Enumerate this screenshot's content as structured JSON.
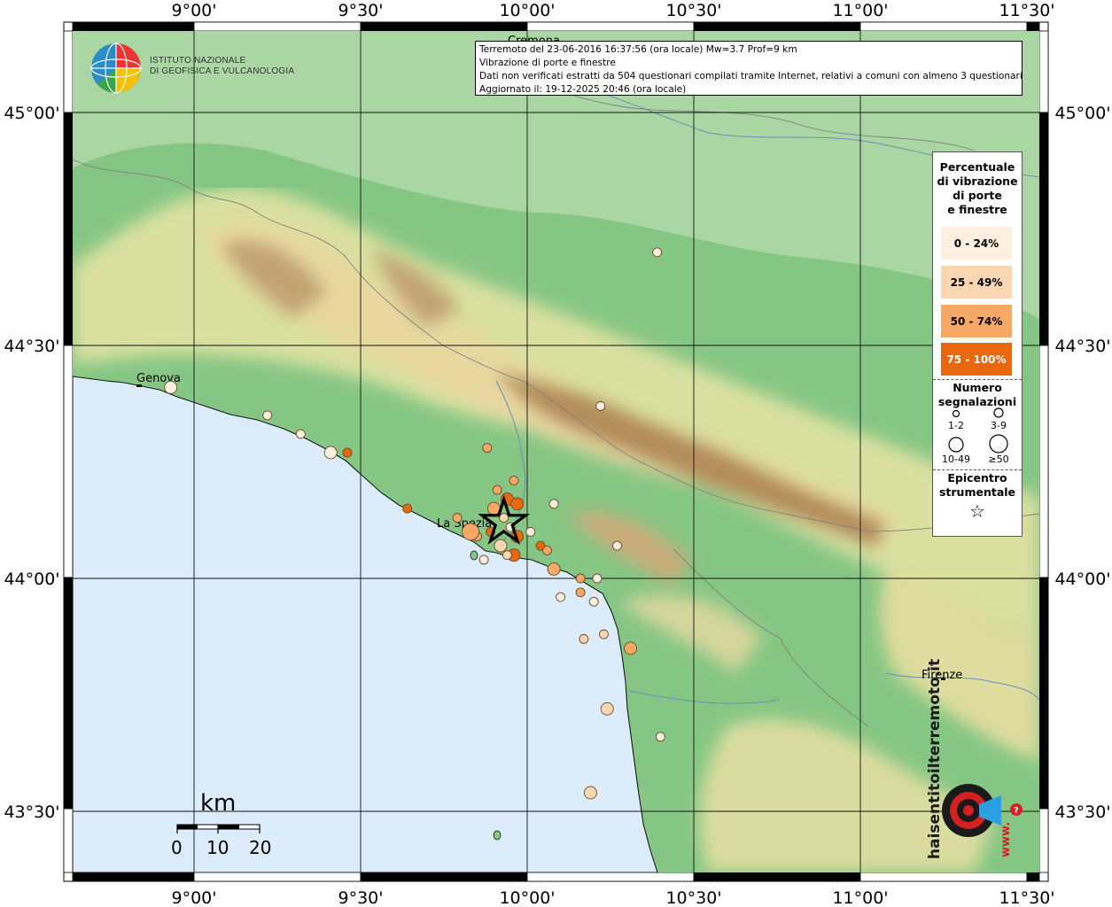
{
  "info": {
    "line1": "Terremoto del 23-06-2016 16:37:56 (ora locale) Mw=3.7 Prof=9 km",
    "line2": "Vibrazione di porte e finestre",
    "line3": "Dati non verificati estratti da 504 questionari compilati tramite Internet, relativi a comuni con almeno 3 questionari.",
    "line4": "Aggiornato il: 19-12-2025 20:46 (ora locale)"
  },
  "logo": {
    "line1": "ISTITUTO NAZIONALE",
    "line2": "DI GEOFISICA E VULCANOLOGIA"
  },
  "grid": {
    "lon_labels": [
      "9°00'",
      "9°30'",
      "10°00'",
      "10°30'",
      "11°00'",
      "11°30'"
    ],
    "lat_labels": [
      "45°00'",
      "44°30'",
      "44°00'",
      "43°30'"
    ]
  },
  "places": {
    "genova": "Genova",
    "la_spezia": "La Spezia",
    "firenze": "Firenze",
    "cremona": "Cremona"
  },
  "legend": {
    "title": "Percentuale\ndi vibrazione\ndi porte\ne finestre",
    "classes": [
      {
        "label": "0 - 24%",
        "color": "#fdf0e0"
      },
      {
        "label": "25 - 49%",
        "color": "#fbd6b2"
      },
      {
        "label": "50 - 74%",
        "color": "#f7a866"
      },
      {
        "label": "75 - 100%",
        "color": "#e86810"
      }
    ],
    "count_title": "Numero\nsegnalazioni",
    "sizes": [
      "1-2",
      "3-9",
      "10-49",
      "≥50"
    ],
    "epicenter_title": "Epicentro\nstrumentale",
    "epicenter_symbol": "☆"
  },
  "scale": {
    "unit": "km",
    "labels": [
      "0",
      "10",
      "20"
    ]
  },
  "watermark": {
    "text": "haisentitoilterremoto.it",
    "url": "www."
  },
  "colors": {
    "sea": "#dcecfa",
    "low_land": "#8cc88c",
    "hills": "#e8dc9c",
    "mountains": "#b08c58"
  },
  "reports": [
    {
      "id": "genova",
      "lon": 8.93,
      "lat": 44.41,
      "pct": 0,
      "size": 2
    },
    {
      "id": "r1",
      "lon": 9.22,
      "lat": 44.35,
      "pct": 0,
      "size": 1
    },
    {
      "id": "r2",
      "lon": 9.32,
      "lat": 44.31,
      "pct": 0,
      "size": 1
    },
    {
      "id": "r3",
      "lon": 9.41,
      "lat": 44.27,
      "pct": 0,
      "size": 2
    },
    {
      "id": "r4",
      "lon": 9.46,
      "lat": 44.27,
      "pct": 3,
      "size": 1
    },
    {
      "id": "r5",
      "lon": 9.64,
      "lat": 44.15,
      "pct": 3,
      "size": 1
    },
    {
      "id": "r6",
      "lon": 9.79,
      "lat": 44.13,
      "pct": 2,
      "size": 1
    },
    {
      "id": "r7",
      "lon": 9.85,
      "lat": 44.09,
      "pct": 2,
      "size": 1
    },
    {
      "id": "spezia",
      "lon": 9.83,
      "lat": 44.1,
      "pct": 2,
      "size": 3
    },
    {
      "id": "r8",
      "lon": 9.87,
      "lat": 44.04,
      "pct": 0,
      "size": 1
    },
    {
      "id": "r9",
      "lon": 9.92,
      "lat": 44.07,
      "pct": 1,
      "size": 2
    },
    {
      "id": "r10",
      "lon": 9.96,
      "lat": 44.05,
      "pct": 3,
      "size": 2
    },
    {
      "id": "r11",
      "lon": 9.94,
      "lat": 44.05,
      "pct": 1,
      "size": 1
    },
    {
      "id": "r12",
      "lon": 9.95,
      "lat": 44.11,
      "pct": 0,
      "size": 1
    },
    {
      "id": "r13",
      "lon": 9.9,
      "lat": 44.15,
      "pct": 2,
      "size": 2
    },
    {
      "id": "r14",
      "lon": 9.94,
      "lat": 44.17,
      "pct": 3,
      "size": 2
    },
    {
      "id": "r15",
      "lon": 9.97,
      "lat": 44.16,
      "pct": 3,
      "size": 2
    },
    {
      "id": "r16",
      "lon": 9.91,
      "lat": 44.19,
      "pct": 2,
      "size": 1
    },
    {
      "id": "r17",
      "lon": 9.96,
      "lat": 44.21,
      "pct": 2,
      "size": 1
    },
    {
      "id": "r18",
      "lon": 9.88,
      "lat": 44.28,
      "pct": 2,
      "size": 1
    },
    {
      "id": "r19",
      "lon": 9.93,
      "lat": 44.13,
      "pct": 1,
      "size": 1
    },
    {
      "id": "r20",
      "lon": 9.89,
      "lat": 44.1,
      "pct": 3,
      "size": 1
    },
    {
      "id": "r21",
      "lon": 9.97,
      "lat": 44.09,
      "pct": 3,
      "size": 2
    },
    {
      "id": "r22",
      "lon": 10.01,
      "lat": 44.1,
      "pct": 0,
      "size": 1
    },
    {
      "id": "r23",
      "lon": 10.04,
      "lat": 44.07,
      "pct": 3,
      "size": 1
    },
    {
      "id": "r24",
      "lon": 10.06,
      "lat": 44.06,
      "pct": 2,
      "size": 1
    },
    {
      "id": "r25",
      "lon": 10.08,
      "lat": 44.02,
      "pct": 2,
      "size": 2
    },
    {
      "id": "r26",
      "lon": 10.08,
      "lat": 44.16,
      "pct": 0,
      "size": 1
    },
    {
      "id": "r27",
      "lon": 10.16,
      "lat": 43.97,
      "pct": 2,
      "size": 1
    },
    {
      "id": "r28",
      "lon": 10.16,
      "lat": 44.0,
      "pct": 2,
      "size": 1
    },
    {
      "id": "r29",
      "lon": 10.21,
      "lat": 44.0,
      "pct": 0,
      "size": 1
    },
    {
      "id": "r30",
      "lon": 10.1,
      "lat": 43.96,
      "pct": 0,
      "size": 1
    },
    {
      "id": "r31",
      "lon": 10.2,
      "lat": 43.95,
      "pct": 0,
      "size": 1
    },
    {
      "id": "r32",
      "lon": 10.17,
      "lat": 43.87,
      "pct": 1,
      "size": 1
    },
    {
      "id": "r33",
      "lon": 10.23,
      "lat": 43.88,
      "pct": 1,
      "size": 1
    },
    {
      "id": "r34",
      "lon": 10.31,
      "lat": 43.85,
      "pct": 2,
      "size": 2
    },
    {
      "id": "r35",
      "lon": 10.27,
      "lat": 44.07,
      "pct": 0,
      "size": 1
    },
    {
      "id": "r36",
      "lon": 10.22,
      "lat": 44.37,
      "pct": 0,
      "size": 1
    },
    {
      "id": "r37",
      "lon": 10.39,
      "lat": 44.7,
      "pct": 0,
      "size": 1
    },
    {
      "id": "r38",
      "lon": 10.24,
      "lat": 43.72,
      "pct": 1,
      "size": 2
    },
    {
      "id": "r39",
      "lon": 10.4,
      "lat": 43.66,
      "pct": 0,
      "size": 1
    },
    {
      "id": "r40",
      "lon": 10.19,
      "lat": 43.54,
      "pct": 1,
      "size": 2
    }
  ],
  "epicenter": {
    "lon": 9.93,
    "lat": 44.12
  }
}
